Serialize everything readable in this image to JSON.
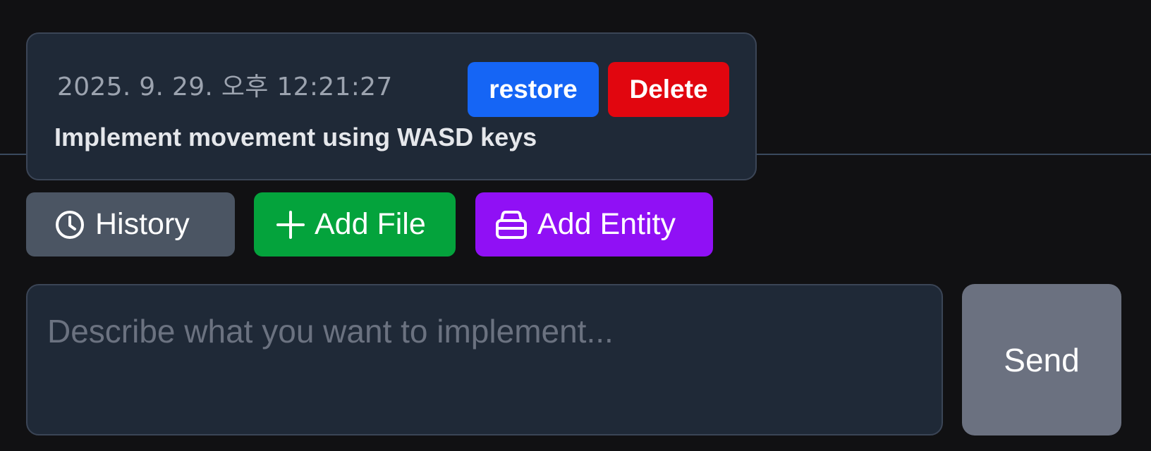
{
  "history_entry": {
    "timestamp": "2025. 9. 29. 오후 12:21:27",
    "prompt": "Implement movement using WASD keys",
    "restore_label": "restore",
    "delete_label": "Delete"
  },
  "toolbar": {
    "history_label": "History",
    "history_icon": "clock-icon",
    "add_file_label": "Add File",
    "add_file_icon": "plus-icon",
    "add_entity_label": "Add Entity",
    "add_entity_icon": "box-icon"
  },
  "composer": {
    "placeholder": "Describe what you want to implement...",
    "value": "",
    "send_label": "Send"
  },
  "colors": {
    "background": "#111113",
    "card": "#1f2937",
    "restore": "#1565f5",
    "delete": "#e1060f",
    "history": "#4b5563",
    "add_file": "#04a33c",
    "add_entity": "#9010f5",
    "send": "#6b7180"
  }
}
